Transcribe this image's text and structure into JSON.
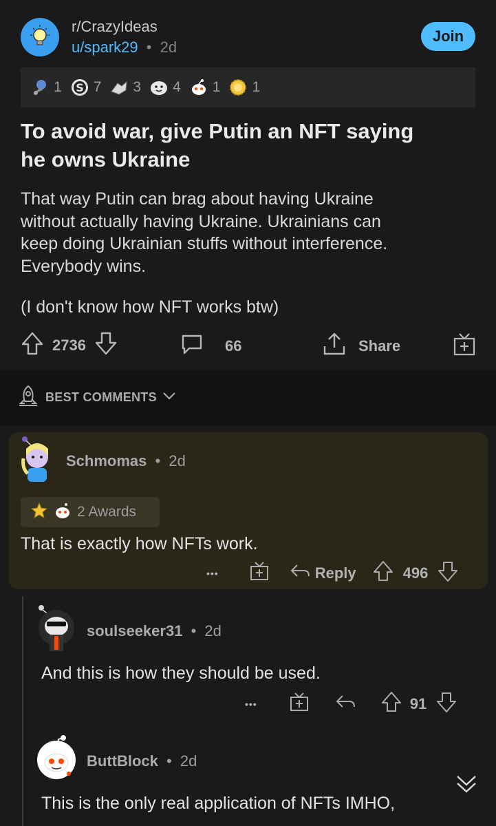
{
  "post": {
    "subreddit": "r/CrazyIdeas",
    "user": "u/spark29",
    "separator": "•",
    "age": "2d",
    "join_label": "Join",
    "awards": [
      {
        "icon": "rocket-like-award-icon",
        "count": "1"
      },
      {
        "icon": "silver-award-icon",
        "count": "7"
      },
      {
        "icon": "helpful-award-icon",
        "count": "3"
      },
      {
        "icon": "wholesome-award-icon",
        "count": "4"
      },
      {
        "icon": "snoo-award-icon",
        "count": "1"
      },
      {
        "icon": "starstruck-award-icon",
        "count": "1"
      }
    ],
    "title_line1": "To avoid war, give Putin an NFT saying",
    "title_line2": "he owns Ukraine",
    "body_lines": [
      "That way Putin can brag about having Ukraine",
      "without actually having Ukraine. Ukrainians can",
      "keep doing Ukrainian stuffs without interference.",
      "Everybody wins."
    ],
    "body_note": "(I don't know how NFT works btw)",
    "votes": "2736",
    "comments": "66",
    "share_label": "Share"
  },
  "sort": {
    "label": "BEST COMMENTS"
  },
  "comments": [
    {
      "author": "Schmomas",
      "age": "2d",
      "awards_label": "2 Awards",
      "text": "That is exactly how NFTs work.",
      "more": "•••",
      "reply_label": "Reply",
      "votes": "496"
    },
    {
      "author": "soulseeker31",
      "age": "2d",
      "text": "And this is how they should be used.",
      "more": "•••",
      "votes": "91"
    },
    {
      "author": "ButtBlock",
      "age": "2d",
      "text": "This is the only real application of NFTs IMHO,"
    }
  ],
  "colors": {
    "accent_blue": "#4fbcff",
    "highlight": "#2b2718",
    "background": "#1a1a1b"
  }
}
